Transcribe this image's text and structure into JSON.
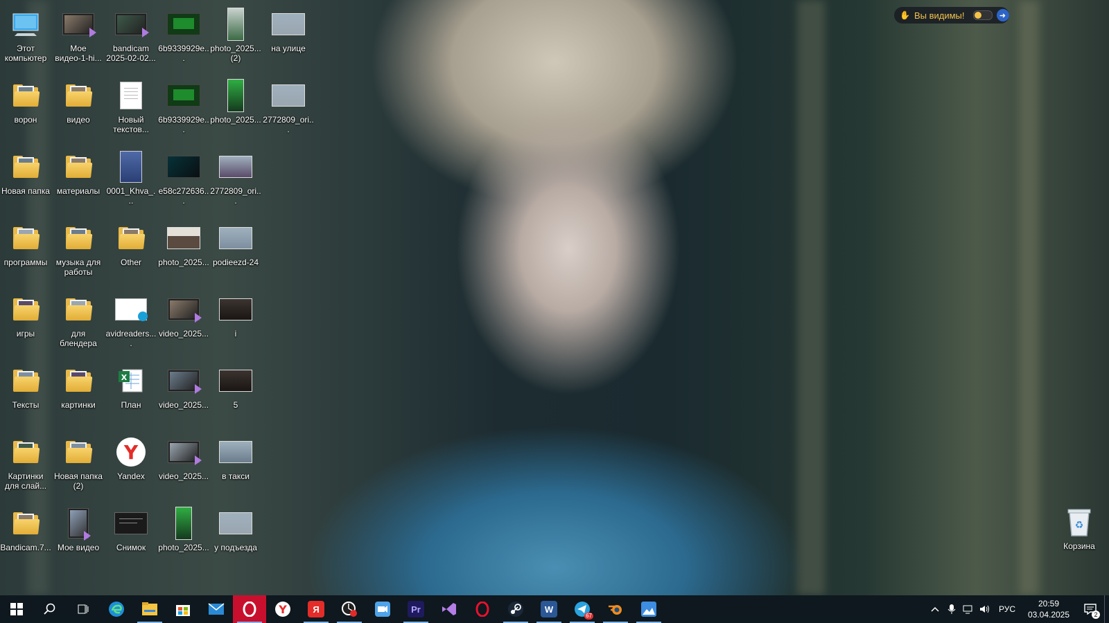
{
  "desktop": {
    "icons": [
      {
        "label": "Этот компьютер"
      },
      {
        "label": "Мое видео-1-hi..."
      },
      {
        "label": "bandicam 2025-02-02..."
      },
      {
        "label": "6b9339929e..."
      },
      {
        "label": "photo_2025... (2)"
      },
      {
        "label": "на улице"
      },
      {
        "label": "ворон"
      },
      {
        "label": "видео"
      },
      {
        "label": "Новый текстов..."
      },
      {
        "label": "6b9339929e..."
      },
      {
        "label": "photo_2025..."
      },
      {
        "label": "2772809_ori..."
      },
      {
        "label": "Новая папка"
      },
      {
        "label": "материалы"
      },
      {
        "label": "0001_Khva_..."
      },
      {
        "label": "e58c272636..."
      },
      {
        "label": "2772809_ori..."
      },
      {
        "label": "программы"
      },
      {
        "label": "музыка для работы"
      },
      {
        "label": "Other"
      },
      {
        "label": "photo_2025..."
      },
      {
        "label": "podieezd-24"
      },
      {
        "label": "игры"
      },
      {
        "label": "для блендера"
      },
      {
        "label": "avidreaders...."
      },
      {
        "label": "video_2025..."
      },
      {
        "label": "i"
      },
      {
        "label": "Тексты"
      },
      {
        "label": "картинки"
      },
      {
        "label": "План"
      },
      {
        "label": "video_2025..."
      },
      {
        "label": "5"
      },
      {
        "label": "Картинки для слай..."
      },
      {
        "label": "Новая папка (2)"
      },
      {
        "label": "Yandex"
      },
      {
        "label": "video_2025..."
      },
      {
        "label": "в такси"
      },
      {
        "label": "Bandicam.7..."
      },
      {
        "label": "Мое видео"
      },
      {
        "label": "Снимок"
      },
      {
        "label": "photo_2025..."
      },
      {
        "label": "у подъезда"
      }
    ],
    "recycle_bin": {
      "label": "Корзина"
    }
  },
  "visibility_widget": {
    "text": "Вы видимы!"
  },
  "taskbar": {
    "apps": [
      {
        "icon": "windows-start-icon"
      },
      {
        "icon": "search-icon"
      },
      {
        "icon": "task-view-icon"
      },
      {
        "icon": "edge-icon"
      },
      {
        "icon": "file-explorer-icon"
      },
      {
        "icon": "microsoft-store-icon"
      },
      {
        "icon": "mail-icon"
      },
      {
        "icon": "opera-gx-icon"
      },
      {
        "icon": "yandex-browser-icon"
      },
      {
        "icon": "yandex-icon",
        "text": "Я"
      },
      {
        "icon": "bandicam-icon"
      },
      {
        "icon": "zoom-icon"
      },
      {
        "icon": "premiere-pro-icon",
        "text": "Pr"
      },
      {
        "icon": "visual-studio-icon"
      },
      {
        "icon": "opera-icon"
      },
      {
        "icon": "steam-icon"
      },
      {
        "icon": "word-icon",
        "text": "W"
      },
      {
        "icon": "telegram-icon",
        "badge": "67"
      },
      {
        "icon": "blender-icon"
      },
      {
        "icon": "photos-icon"
      }
    ],
    "tray": {
      "language": "РУС",
      "time": "20:59",
      "date": "03.04.2025",
      "notifications": "2"
    }
  },
  "colors": {
    "taskbar": "#0e181e",
    "accent": "#7eb4ea",
    "opera_gx": "#c8102e",
    "folder": "#e8b94a"
  }
}
